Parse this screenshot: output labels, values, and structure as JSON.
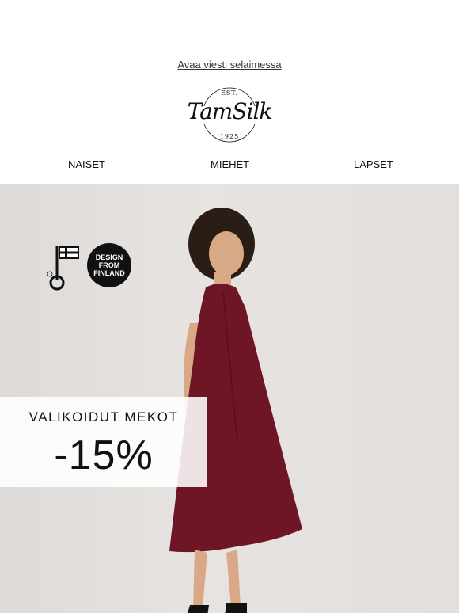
{
  "header": {
    "view_online": "Avaa viesti selaimessa",
    "logo": {
      "est": "EST.",
      "brand": "TamSilk",
      "year": "1925"
    }
  },
  "nav": {
    "items": [
      {
        "label": "NAISET"
      },
      {
        "label": "MIEHET"
      },
      {
        "label": "LAPSET"
      }
    ]
  },
  "hero": {
    "badges": {
      "design_from_finland": [
        "DESIGN",
        "FROM",
        "FINLAND"
      ]
    },
    "promo": {
      "title": "VALIKOIDUT MEKOT",
      "discount": "-15%"
    },
    "colors": {
      "dress": "#6e1526",
      "background": "#e3e0de"
    }
  }
}
